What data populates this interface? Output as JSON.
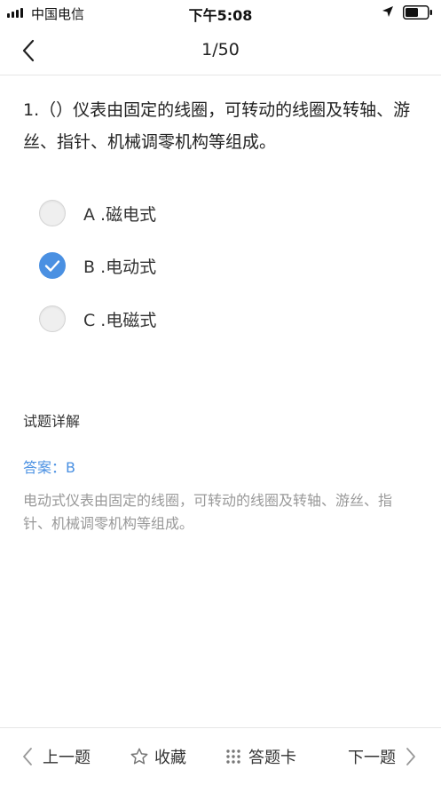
{
  "status_bar": {
    "carrier": "中国电信",
    "time": "下午5:08"
  },
  "nav": {
    "title": "1/50",
    "back_icon": "chevron-left-icon"
  },
  "question": {
    "text": "1.（）仪表由固定的线圈，可转动的线圈及转轴、游丝、指针、机械调零机构等组成。",
    "options": [
      {
        "label": "A .磁电式",
        "selected": false
      },
      {
        "label": "B .电动式",
        "selected": true
      },
      {
        "label": "C .电磁式",
        "selected": false
      }
    ]
  },
  "explanation": {
    "heading": "试题详解",
    "answer": "答案：B",
    "analysis": "电动式仪表由固定的线圈，可转动的线圈及转轴、游丝、指针、机械调零机构等组成。"
  },
  "toolbar": {
    "prev_label": "上一题",
    "favorite_label": "收藏",
    "answer_card_label": "答题卡",
    "next_label": "下一题"
  },
  "colors": {
    "accent": "#4a90e2",
    "muted_text": "#999999"
  }
}
